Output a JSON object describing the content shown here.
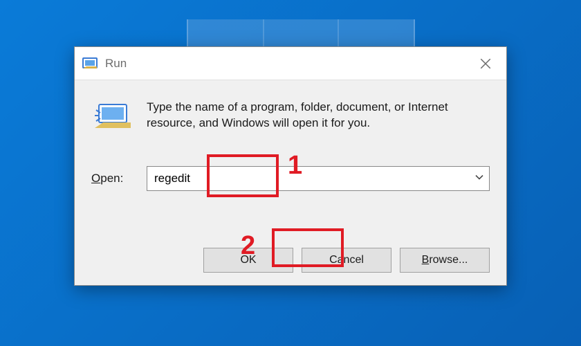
{
  "dialog": {
    "title": "Run",
    "description": "Type the name of a program, folder, document, or Internet resource, and Windows will open it for you.",
    "open_label_prefix": "O",
    "open_label_rest": "pen:",
    "input_value": "regedit",
    "buttons": {
      "ok": "OK",
      "cancel": "Cancel",
      "browse_prefix": "B",
      "browse_rest": "rowse..."
    }
  },
  "annotations": {
    "step1": "1",
    "step2": "2"
  }
}
